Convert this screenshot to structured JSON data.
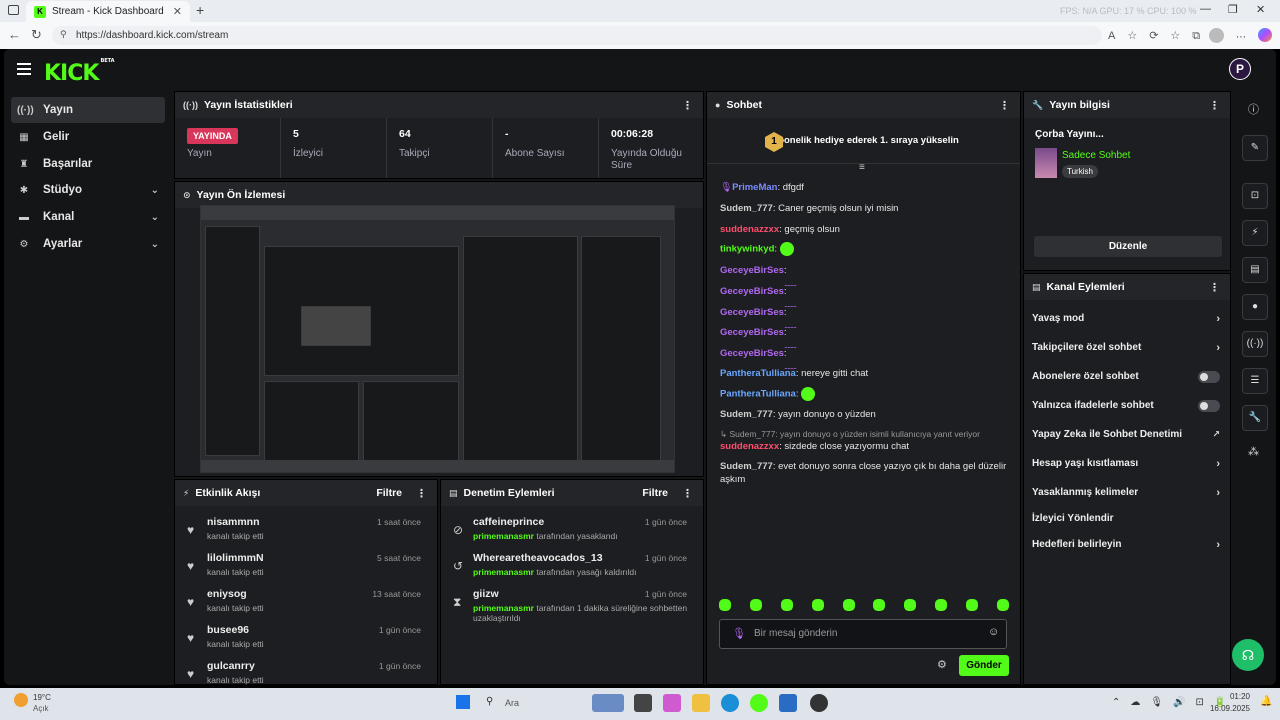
{
  "browser": {
    "tab_title": "Stream - Kick Dashboard",
    "url": "https://dashboard.kick.com/stream",
    "perf": "FPS: N/A  GPU: 17 %  CPU: 100 %"
  },
  "header": {
    "logo": "KICK",
    "logo_badge": "BETA",
    "avatar_letter": "P"
  },
  "sidebar": {
    "items": [
      {
        "label": "Yayın",
        "icon": "broadcast-icon",
        "active": true
      },
      {
        "label": "Gelir",
        "icon": "revenue-icon"
      },
      {
        "label": "Başarılar",
        "icon": "trophy-icon"
      },
      {
        "label": "Stüdyo",
        "icon": "studio-icon",
        "expand": true
      },
      {
        "label": "Kanal",
        "icon": "channel-icon",
        "expand": true
      },
      {
        "label": "Ayarlar",
        "icon": "gear-icon",
        "expand": true
      }
    ]
  },
  "stats": {
    "title": "Yayın İstatistikleri",
    "live_label": "YAYINDA",
    "items": [
      {
        "value": "",
        "label": "Yayın"
      },
      {
        "value": "5",
        "label": "İzleyici"
      },
      {
        "value": "64",
        "label": "Takipçi"
      },
      {
        "value": "-",
        "label": "Abone Sayısı"
      },
      {
        "value": "00:06:28",
        "label": "Yayında Olduğu Süre"
      }
    ]
  },
  "preview": {
    "title": "Yayın Ön İzlemesi"
  },
  "activity": {
    "title": "Etkinlik Akışı",
    "filter": "Filtre",
    "items": [
      {
        "name": "nisammnn",
        "text": "kanalı takip etti",
        "time": "1 saat önce"
      },
      {
        "name": "lilolimmmN",
        "text": "kanalı takip etti",
        "time": "5 saat önce"
      },
      {
        "name": "eniysog",
        "text": "kanalı takip etti",
        "time": "13 saat önce"
      },
      {
        "name": "busee96",
        "text": "kanalı takip etti",
        "time": "1 gün önce"
      },
      {
        "name": "gulcanrry",
        "text": "kanalı takip etti",
        "time": "1 gün önce"
      }
    ]
  },
  "moderation": {
    "title": "Denetim Eylemleri",
    "filter": "Filtre",
    "items": [
      {
        "name": "caffeineprince",
        "actor": "primemanasmr",
        "text": "tarafından yasaklandı",
        "time": "1 gün önce",
        "icon": "ban-icon"
      },
      {
        "name": "Wherearetheavocados_13",
        "actor": "primemanasmr",
        "text": "tarafından yasağı kaldırıldı",
        "time": "1 gün önce",
        "icon": "undo-icon"
      },
      {
        "name": "giizw",
        "actor": "primemanasmr",
        "text": "tarafından 1 dakika süreliğine sohbetten",
        "text2": "uzaklaştırıldı",
        "time": "1 gün önce",
        "icon": "hourglass-icon"
      }
    ]
  },
  "chat": {
    "title": "Sohbet",
    "banner": "1 abonelik hediye ederek 1. sıraya yükselin",
    "banner_badge": "1",
    "messages": [
      {
        "user": "PrimeMan",
        "text": "dfgdf",
        "color": "#7b8cff"
      },
      {
        "user": "Sudem_777",
        "text": "Caner geçmiş olsun iyi misin",
        "color": "#cfcfcf"
      },
      {
        "user": "suddenazzxx",
        "text": "geçmiş olsun",
        "color": "#ff4d6d"
      },
      {
        "user": "tinkywinkyd",
        "text": "",
        "color": "#53fc18",
        "emote": true
      },
      {
        "user": "GeceyeBirSes",
        "text": "........",
        "color": "#b068f0"
      },
      {
        "user": "GeceyeBirSes",
        "text": "........",
        "color": "#b068f0"
      },
      {
        "user": "GeceyeBirSes",
        "text": "........",
        "color": "#b068f0"
      },
      {
        "user": "GeceyeBirSes",
        "text": "........",
        "color": "#b068f0"
      },
      {
        "user": "GeceyeBirSes",
        "text": "........",
        "color": "#b068f0"
      },
      {
        "user": "PantheraTulliana",
        "text": "nereye gitti chat",
        "color": "#6aa7ff"
      },
      {
        "user": "PantheraTulliana",
        "text": "",
        "color": "#6aa7ff",
        "emote": true
      },
      {
        "user": "Sudem_777",
        "text": "yayın donuyo o yüzden",
        "color": "#cfcfcf"
      },
      {
        "reply": "Sudem_777: yayın donuyo o yüzden isimli kullanıcıya yanıt veriyor"
      },
      {
        "user": "suddenazzxx",
        "text": "sizdede close yazıyormu chat",
        "color": "#ff4d6d"
      },
      {
        "user": "Sudem_777",
        "text": "evet donuyo sonra close yazıyo çık bı daha gel düzelir",
        "text2": "aşkım",
        "color": "#cfcfcf"
      }
    ],
    "input_placeholder": "Bir mesaj gönderin",
    "send_label": "Gönder"
  },
  "stream_info": {
    "title": "Yayın bilgisi",
    "stream_title": "Çorba Yayını...",
    "category": "Sadece Sohbet",
    "tag": "Turkish",
    "edit_label": "Düzenle"
  },
  "channel_actions": {
    "title": "Kanal Eylemleri",
    "items": [
      {
        "label": "Yavaş mod",
        "type": "arrow"
      },
      {
        "label": "Takipçilere özel sohbet",
        "type": "arrow"
      },
      {
        "label": "Abonelere özel sohbet",
        "type": "toggle"
      },
      {
        "label": "Yalnızca ifadelerle sohbet",
        "type": "toggle"
      },
      {
        "label": "Yapay Zeka ile Sohbet Denetimi",
        "type": "external"
      },
      {
        "label": "Hesap yaşı kısıtlaması",
        "type": "arrow"
      },
      {
        "label": "Yasaklanmış kelimeler",
        "type": "arrow"
      },
      {
        "label": "İzleyici Yönlendir",
        "type": "none"
      },
      {
        "label": "Hedefleri belirleyin",
        "type": "arrow"
      }
    ]
  },
  "taskbar": {
    "weather_temp": "19°C",
    "weather_desc": "Açık",
    "search_placeholder": "Ara",
    "time": "01:20",
    "date": "16.09.2025"
  },
  "colors": {
    "accent": "#53fc18",
    "live": "#d9365b"
  }
}
